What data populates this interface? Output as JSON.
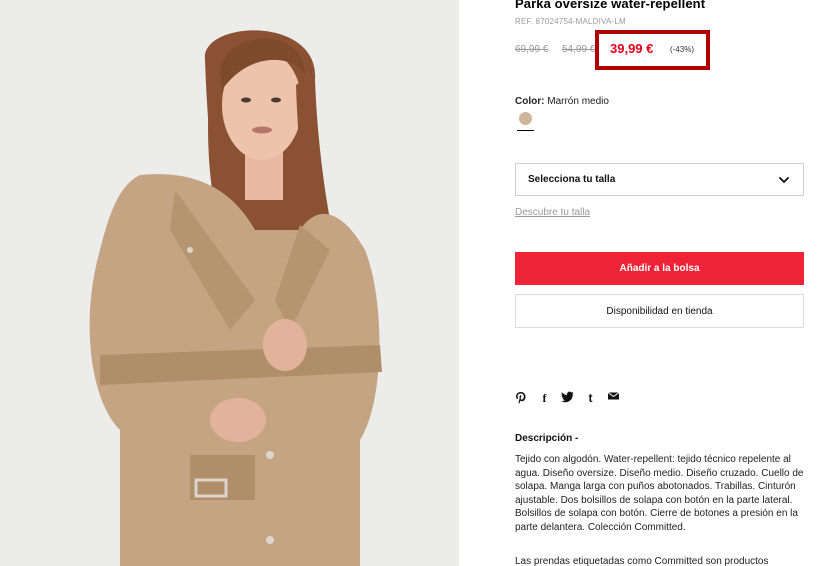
{
  "product": {
    "title": "Parka oversize water-repellent",
    "ref": "REF. 87024754-MALDIVA-LM",
    "image_alt": "Mujer con parka oversize beige"
  },
  "prices": {
    "original": "69,99 €",
    "previous": "54,99 €",
    "sale": "39,99 €",
    "discount": "(-43%)"
  },
  "color": {
    "label": "Color:",
    "value": "Marrón medio",
    "swatch_hex": "#cfb69a"
  },
  "size": {
    "select_label": "Selecciona tu talla",
    "guide_link": "Descubre tu talla"
  },
  "actions": {
    "add_to_bag": "Añadir a la bolsa",
    "store_availability": "Disponibilidad en tienda"
  },
  "share_icons": [
    "pinterest-icon",
    "facebook-icon",
    "twitter-icon",
    "tumblr-icon",
    "email-icon"
  ],
  "description": {
    "title": "Descripción -",
    "text": "Tejido con algodón. Water-repellent: tejido técnico repelente al agua. Diseño oversize. Diseño medio. Diseño cruzado. Cuello de solapa. Manga larga con puños abotonados. Trabillas. Cinturón ajustable. Dos bolsillos de solapa con botón en la parte lateral. Bolsillos de solapa con botón. Cierre de botones a presión en la parte delantera. Colección Committed.",
    "more": "Las prendas etiquetadas como Committed son productos"
  },
  "colors": {
    "accent_red": "#ee2436",
    "sale_red": "#e4001b",
    "highlight_border": "#b00000"
  }
}
